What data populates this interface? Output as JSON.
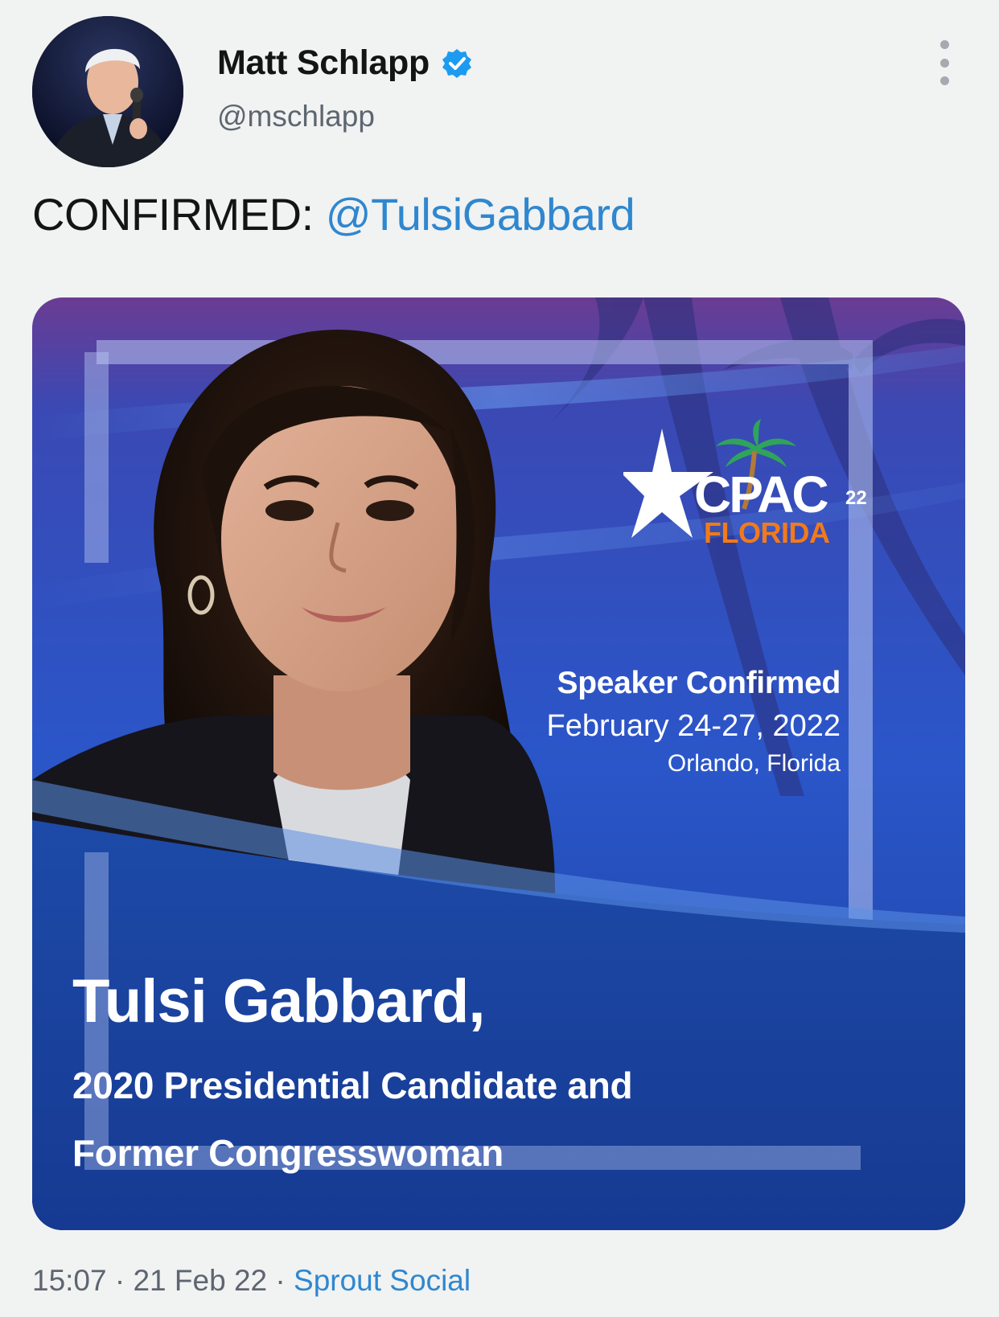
{
  "tweet": {
    "author_name": "Matt Schlapp",
    "handle": "@mschlapp",
    "text_prefix": "CONFIRMED: ",
    "mention": "@TulsiGabbard",
    "time": "15:07",
    "date": "21 Feb 22",
    "separator": "·",
    "source": "Sprout Social"
  },
  "card": {
    "logo_main": "CPAC",
    "logo_year": "22",
    "logo_sub": "FLORIDA",
    "speaker_label": "Speaker Confirmed",
    "dates": "February 24-27, 2022",
    "location": "Orlando, Florida",
    "speaker_name": "Tulsi Gabbard,",
    "title_line1": "2020 Presidential Candidate and",
    "title_line2": "Former Congresswoman"
  },
  "colors": {
    "link": "#2f87cf",
    "verified": "#1d9bf0",
    "card_blue": "#1a3f9c",
    "logo_orange": "#f27a1a"
  },
  "icons": {
    "verified": "verified-badge-icon",
    "more": "more-options-icon"
  }
}
